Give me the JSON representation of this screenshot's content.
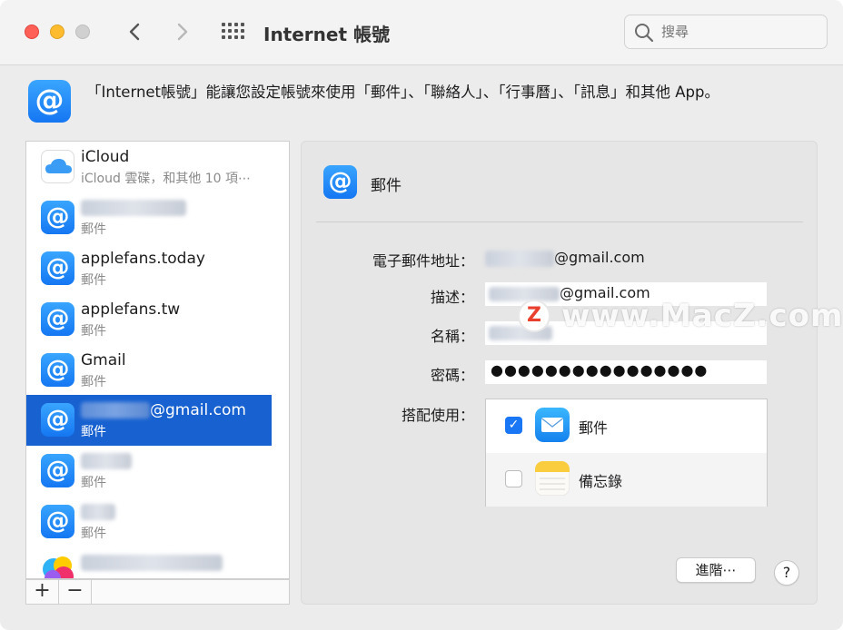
{
  "window": {
    "title": "Internet 帳號",
    "search_placeholder": "搜尋"
  },
  "header": {
    "description": "「Internet帳號」能讓您設定帳號來使用「郵件」、「聯絡人」、「行事曆」、「訊息」和其他 App。"
  },
  "accounts": [
    {
      "name": "iCloud",
      "subtitle": "iCloud 雲碟，和其他 10 項⋯",
      "icon": "icloud-icon",
      "selected": false
    },
    {
      "name": "",
      "subtitle": "郵件",
      "icon": "at-icon",
      "selected": false,
      "name_blurred": true
    },
    {
      "name": "applefans.today",
      "subtitle": "郵件",
      "icon": "at-icon",
      "selected": false
    },
    {
      "name": "applefans.tw",
      "subtitle": "郵件",
      "icon": "at-icon",
      "selected": false
    },
    {
      "name": "Gmail",
      "subtitle": "郵件",
      "icon": "at-icon",
      "selected": false
    },
    {
      "name": "@gmail.com",
      "subtitle": "郵件",
      "icon": "at-icon",
      "selected": true,
      "name_blurred": true
    },
    {
      "name": "",
      "subtitle": "郵件",
      "icon": "at-icon",
      "selected": false,
      "name_blurred": true
    },
    {
      "name": "",
      "subtitle": "郵件",
      "icon": "at-icon",
      "selected": false,
      "name_blurred": true
    },
    {
      "name": "",
      "subtitle": "",
      "icon": "game-center-icon",
      "selected": false,
      "name_blurred": true
    }
  ],
  "sidebar_footer": {
    "add_label": "+",
    "remove_label": "−"
  },
  "detail": {
    "title": "郵件",
    "email_label": "電子郵件地址：",
    "email_value": "@gmail.com",
    "description_label": "描述：",
    "description_value": "@gmail.com",
    "name_label": "名稱：",
    "name_value": "",
    "password_label": "密碼：",
    "password_value": "●●●●●●●●●●●●●●●●",
    "use_with_label": "搭配使用：",
    "apps": [
      {
        "label": "郵件",
        "checked": true,
        "icon": "mail-app-icon"
      },
      {
        "label": "備忘錄",
        "checked": false,
        "icon": "notes-app-icon"
      }
    ],
    "advanced_label": "進階⋯",
    "help_label": "?"
  },
  "watermark": {
    "badge": "Z",
    "text": "www.MacZ.com"
  },
  "colors": {
    "accent": "#1761d0",
    "checkbox": "#1976f5",
    "close": "#fe5f57",
    "minimize": "#febc2e"
  }
}
